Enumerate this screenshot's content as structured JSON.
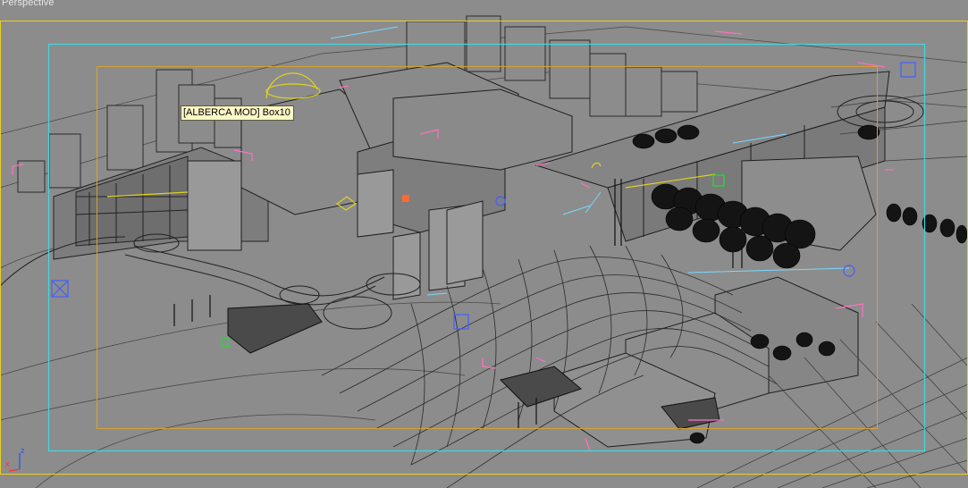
{
  "viewport": {
    "label": "Perspective",
    "background": "#8c8c8c"
  },
  "tooltip": {
    "text": "[ALBERCA MOD] Box10"
  },
  "axis_gizmo": {
    "z_label": "z",
    "x_label": "x",
    "z_color": "#3050ff",
    "x_color": "#ff3030"
  },
  "frames": {
    "safe_frame_outer_color": "#e8d020",
    "safe_frame_action_color": "#40d8e0",
    "safe_frame_title_color": "#d8a030"
  },
  "colors": {
    "wire": "#2a2a2a",
    "wire_light": "#505050",
    "selection": "#ff70c0",
    "helper": "#7ad8ff",
    "trees": "#101010",
    "light_gizmo": "#4060ff",
    "camera_gizmo": "#30d040",
    "highlight_yellow": "#e0d020"
  }
}
